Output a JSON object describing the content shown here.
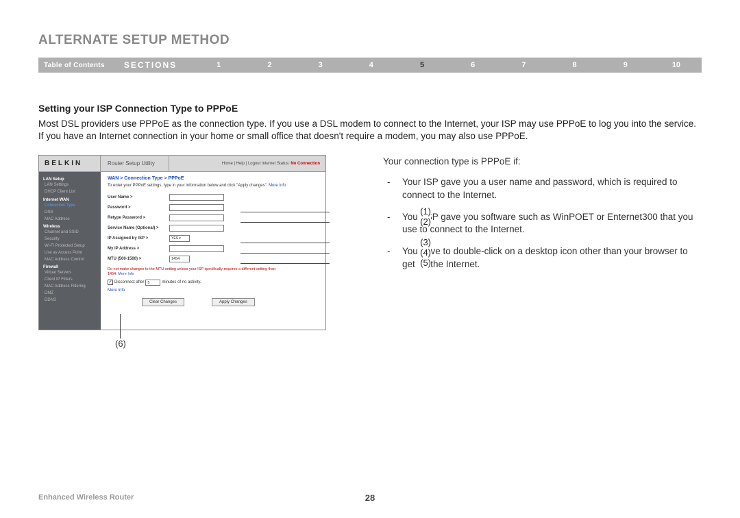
{
  "header": {
    "title": "ALTERNATE SETUP METHOD",
    "toc_label": "Table of Contents",
    "sections_label": "SECTIONS",
    "sections": [
      "1",
      "2",
      "3",
      "4",
      "5",
      "6",
      "7",
      "8",
      "9",
      "10"
    ],
    "active_section": "5"
  },
  "content": {
    "subheading": "Setting your ISP Connection Type to PPPoE",
    "paragraph": "Most DSL providers use PPPoE as the connection type. If you use a DSL modem to connect to the Internet, your ISP may use PPPoE to log you into the service. If you have an Internet connection in your home or small office that doesn't require a modem, you may also use PPPoE.",
    "right": {
      "lead": "Your connection type is PPPoE if:",
      "bullets": [
        "Your ISP gave you a user name and password, which is required to connect to the Internet.",
        "Your ISP gave you software such as WinPOET or Enternet300 that you use to connect to the Internet.",
        "You have to double-click on a desktop icon other than your browser to get on the Internet."
      ]
    }
  },
  "screenshot": {
    "logo": "BELKIN",
    "utility_title": "Router Setup Utility",
    "topnav": "Home | Help | Logout   Internet Status:",
    "status": "No Connection",
    "sidebar": {
      "groups": [
        {
          "title": "LAN Setup",
          "items": [
            "LAN Settings",
            "DHCP Client List"
          ]
        },
        {
          "title": "Internet WAN",
          "items": [
            "Connection Type",
            "DNS",
            "MAC Address"
          ],
          "active": 0
        },
        {
          "title": "Wireless",
          "items": [
            "Channel and SSID",
            "Security",
            "Wi-Fi Protected Setup",
            "Use as Access Point",
            "MAC Address Control"
          ]
        },
        {
          "title": "Firewall",
          "items": [
            "Virtual Servers",
            "Client IP Filters",
            "MAC Address Filtering",
            "DMZ",
            "DDNS"
          ]
        }
      ]
    },
    "breadcrumb": "WAN > Connection Type > PPPoE",
    "description": "To enter your PPPoE settings, type in your information below and click \"Apply changes\".",
    "more_info": "More Info",
    "form": {
      "username": "User Name >",
      "password": "Password >",
      "retype_password": "Retype Password >",
      "service_name": "Service Name (Optional) >",
      "ip_assigned": "IP Assigned by ISP >",
      "ip_assigned_value": "YES ▾",
      "my_ip": "My IP Address >",
      "mtu": "MTU (500-1500) >",
      "mtu_value": "1454"
    },
    "warning": "Do not make changes to the MTU setting unless your ISP specifically requires a different setting than 1454.",
    "more_info2": "More Info",
    "disconnect_label_pre": "Disconnect after",
    "disconnect_value": "5",
    "disconnect_label_post": "minutes of no activity.",
    "bottom_more": "More Info",
    "btn_clear": "Clear Changes",
    "btn_apply": "Apply Changes"
  },
  "callouts": {
    "c1": "(1)",
    "c2": "(2)",
    "c3": "(3)",
    "c4": "(4)",
    "c5": "(5)",
    "c6": "(6)"
  },
  "footer": {
    "product": "Enhanced Wireless Router",
    "page": "28"
  }
}
